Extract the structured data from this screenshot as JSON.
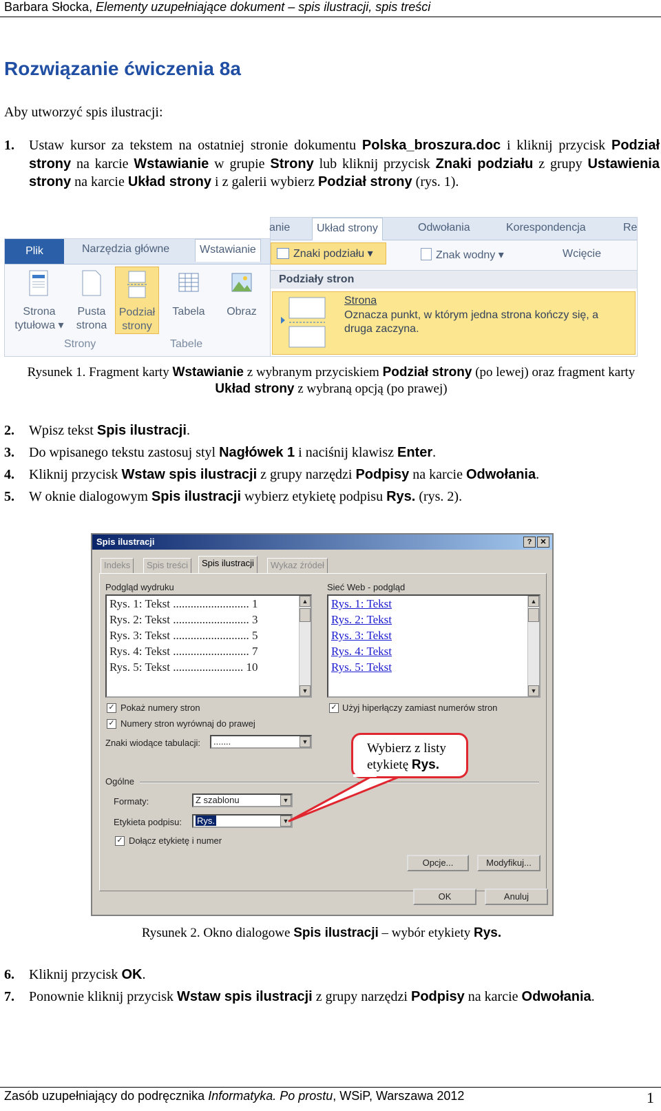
{
  "header": {
    "author": "Barbara Słocka, ",
    "title_italic": "Elementy uzupełniające dokument – spis ilustracji, spis treści"
  },
  "title": "Rozwiązanie ćwiczenia 8a",
  "intro": "Aby utworzyć spis ilustracji:",
  "steps": {
    "s1": {
      "num": "1.",
      "t1": "Ustaw kursor za tekstem na ostatniej stronie dokumentu ",
      "b1": "Polska_broszura.doc",
      "t2": " i kliknij przycisk ",
      "b2": "Podział strony",
      "t3": " na karcie ",
      "b3": "Wstawianie",
      "t4": " w grupie ",
      "b4": "Strony",
      "t5": " lub kliknij przycisk ",
      "b5": "Znaki podziału",
      "t6": " z grupy ",
      "b6": "Ustawienia strony",
      "t7": " na karcie ",
      "b7": "Układ strony",
      "t8": " i z galerii wybierz ",
      "b8": "Podział strony",
      "t9": " (rys. 1)."
    },
    "s2": {
      "num": "2.",
      "t1": "Wpisz tekst ",
      "b1": "Spis ilustracji",
      "t2": "."
    },
    "s3": {
      "num": "3.",
      "t1": "Do wpisanego tekstu zastosuj styl ",
      "b1": "Nagłówek 1",
      "t2": " i naciśnij klawisz ",
      "b2": "Enter",
      "t3": "."
    },
    "s4": {
      "num": "4.",
      "t1": "Kliknij przycisk ",
      "b1": "Wstaw spis ilustracji",
      "t2": " z grupy narzędzi ",
      "b2": "Podpisy",
      "t3": " na karcie ",
      "b3": "Odwołania",
      "t4": "."
    },
    "s5": {
      "num": "5.",
      "t1": "W oknie dialogowym ",
      "b1": "Spis ilustracji",
      "t2": " wybierz etykietę podpisu ",
      "b2": "Rys.",
      "t3": " (rys. 2)."
    },
    "s6": {
      "num": "6.",
      "t1": "Kliknij przycisk ",
      "b1": "OK",
      "t2": "."
    },
    "s7": {
      "num": "7.",
      "t1": "Ponownie kliknij przycisk ",
      "b1": "Wstaw spis ilustracji",
      "t2": " z grupy narzędzi ",
      "b2": "Podpisy",
      "t3": " na karcie ",
      "b3": "Odwołania",
      "t4": "."
    }
  },
  "caption1": {
    "t1": "Rysunek 1. Fragment karty ",
    "b1": "Wstawianie",
    "t2": " z wybranym przyciskiem ",
    "b2": "Podział strony",
    "t3": " (po lewej) oraz fragment karty ",
    "b3": "Układ strony",
    "t4": " z wybraną opcją (po prawej)"
  },
  "caption2": {
    "t1": "Rysunek 2. Okno dialogowe ",
    "b1": "Spis ilustracji",
    "t2": " – wybór etykiety ",
    "b2": "Rys."
  },
  "ribbon_left": {
    "tabs": {
      "file": "Plik",
      "home": "Narzędzia główne",
      "insert": "Wstawianie"
    },
    "buttons": {
      "cover": "Strona\ntytułowa ▾",
      "blank": "Pusta\nstrona",
      "break": "Podział\nstrony",
      "table": "Tabela",
      "picture": "Obraz"
    },
    "groups": {
      "pages": "Strony",
      "tables": "Tabele"
    }
  },
  "ribbon_right": {
    "tabs": {
      "insert_partial": "anie",
      "layout": "Układ strony",
      "refs": "Odwołania",
      "mail": "Korespondencja",
      "review_partial": "Re"
    },
    "breaks_btn": "Znaki podziału ▾",
    "watermark": "Znak wodny ▾",
    "indent": "Wcięcie",
    "panel_title": "Podziały stron",
    "item_title": "Strona",
    "item_desc": "Oznacza punkt, w którym jedna strona kończy się, a druga zaczyna."
  },
  "dialog": {
    "title": "Spis ilustracji",
    "help": "?",
    "close": "✕",
    "tabs": {
      "index": "Indeks",
      "toc": "Spis treści",
      "tof": "Spis ilustracji",
      "toa": "Wykaz źródeł"
    },
    "print_preview_label": "Podgląd wydruku",
    "web_preview_label": "Sieć Web - podgląd",
    "print_rows": [
      "Rys. 1: Tekst .......................... 1",
      "Rys. 2: Tekst .......................... 3",
      "Rys. 3: Tekst .......................... 5",
      "Rys. 4: Tekst .......................... 7",
      "Rys. 5: Tekst ........................ 10"
    ],
    "web_rows": [
      "Rys. 1: Tekst",
      "Rys. 2: Tekst",
      "Rys. 3: Tekst",
      "Rys. 4: Tekst",
      "Rys. 5: Tekst"
    ],
    "show_page_numbers": "Pokaż numery stron",
    "right_align": "Numery stron wyrównaj do prawej",
    "tab_leader_label": "Znaki wiodące tabulacji:",
    "tab_leader_value": ".......",
    "use_hyperlinks": "Użyj hiperłączy zamiast numerów stron",
    "general_label": "Ogólne",
    "formats_label": "Formaty:",
    "formats_value": "Z szablonu",
    "caption_label": "Etykieta podpisu:",
    "caption_value": "Rys.",
    "include_label": "Dołącz etykietę i numer",
    "options_btn": "Opcje...",
    "modify_btn": "Modyfikuj...",
    "ok_btn": "OK",
    "cancel_btn": "Anuluj",
    "check_mark": "✓"
  },
  "callout": {
    "t1": "Wybierz z listy",
    "t2": "etykietę ",
    "b1": "Rys."
  },
  "footer": {
    "t1": "Zasób uzupełniający do podręcznika ",
    "i1": "Informatyka. Po prostu",
    "t2": ", WSiP, Warszawa 2012"
  },
  "page_number": "1"
}
